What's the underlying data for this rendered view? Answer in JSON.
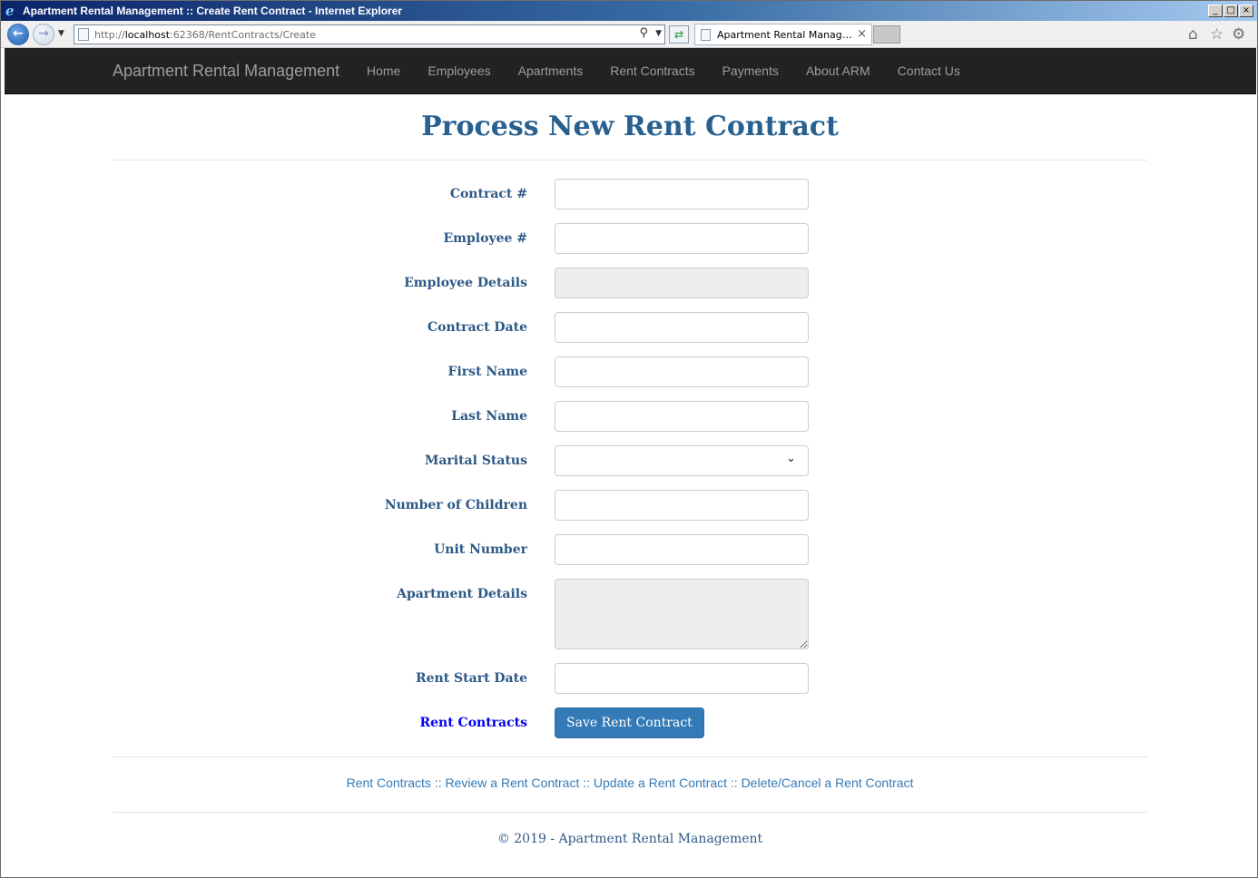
{
  "window": {
    "title": "Apartment Rental Management :: Create Rent Contract - Internet Explorer",
    "controls": {
      "minimize": "_",
      "maximize": "□",
      "close": "×"
    }
  },
  "browser": {
    "url_prefix": "http://",
    "url_host": "localhost",
    "url_rest": ":62368/RentContracts/Create",
    "tab_title": "Apartment Rental Managem...",
    "icons": [
      "back-arrow-icon",
      "forward-arrow-icon",
      "search-icon",
      "refresh-icon",
      "home-icon",
      "favorites-star-icon",
      "settings-gear-icon"
    ]
  },
  "navbar": {
    "brand": "Apartment Rental Management",
    "links": [
      "Home",
      "Employees",
      "Apartments",
      "Rent Contracts",
      "Payments",
      "About ARM",
      "Contact Us"
    ]
  },
  "page": {
    "title": "Process New Rent Contract"
  },
  "form": {
    "fields": [
      {
        "label": "Contract #",
        "value": ""
      },
      {
        "label": "Employee #",
        "value": ""
      },
      {
        "label": "Employee Details",
        "value": ""
      },
      {
        "label": "Contract Date",
        "value": ""
      },
      {
        "label": "First Name",
        "value": ""
      },
      {
        "label": "Last Name",
        "value": ""
      },
      {
        "label": "Marital Status",
        "value": ""
      },
      {
        "label": "Number of Children",
        "value": ""
      },
      {
        "label": "Unit Number",
        "value": ""
      },
      {
        "label": "Apartment Details",
        "value": ""
      },
      {
        "label": "Rent Start Date",
        "value": ""
      }
    ],
    "back_link": "Rent Contracts",
    "submit_label": "Save Rent Contract"
  },
  "footer": {
    "links": [
      "Rent Contracts",
      "Review a Rent Contract",
      "Update a Rent Contract",
      "Delete/Cancel a Rent Contract"
    ],
    "separator": "::",
    "copyright": "© 2019 - Apartment Rental Management"
  },
  "colors": {
    "navbar_bg": "#222222",
    "title_blue": "#286090",
    "label_blue": "#2d5986",
    "link_blue": "#337ab7",
    "button_blue": "#337ab7"
  }
}
